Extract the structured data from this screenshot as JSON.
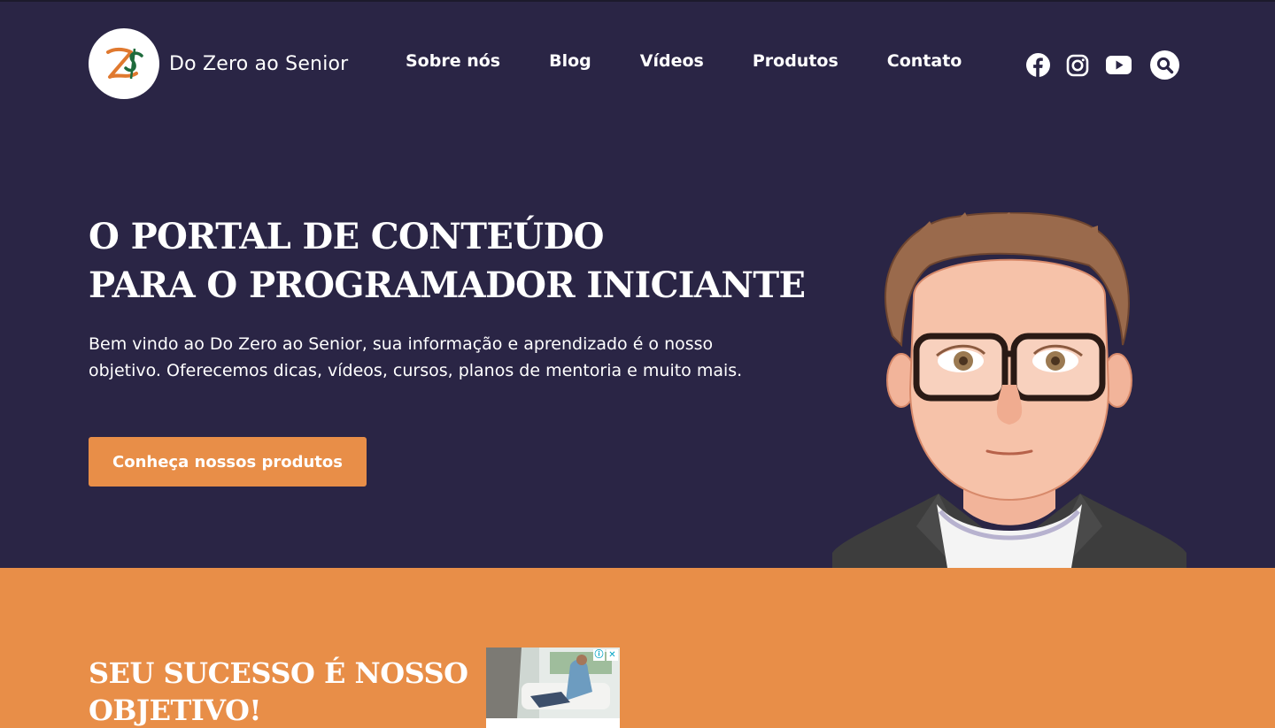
{
  "site": {
    "logo_monogram": "Z$",
    "logo_text": "Do Zero ao Senior"
  },
  "nav": {
    "items": [
      {
        "label": "Sobre nós"
      },
      {
        "label": "Blog"
      },
      {
        "label": "Vídeos"
      },
      {
        "label": "Produtos"
      },
      {
        "label": "Contato"
      }
    ]
  },
  "social": {
    "icons": [
      "facebook-icon",
      "instagram-icon",
      "youtube-icon"
    ],
    "search_icon": "search-icon"
  },
  "hero": {
    "title_line1": "O PORTAL DE CONTEÚDO",
    "title_line2": "PARA O PROGRAMADOR INICIANTE",
    "text": "Bem vindo ao Do Zero ao Senior, sua informação e aprendizado é o nosso objetivo. Oferecemos dicas, vídeos, cursos, planos de mentoria e muito mais.",
    "cta_label": "Conheça nossos produtos"
  },
  "section2": {
    "title_line1": "SEU SUCESSO É NOSSO",
    "title_line2": "OBJETIVO!"
  },
  "ad": {
    "info_icon": "ⓘ",
    "close_icon": "✕"
  },
  "colors": {
    "background": "#2a2545",
    "accent": "#e88e48",
    "logo_orange": "#e0792f",
    "logo_green": "#1e6b3c"
  }
}
